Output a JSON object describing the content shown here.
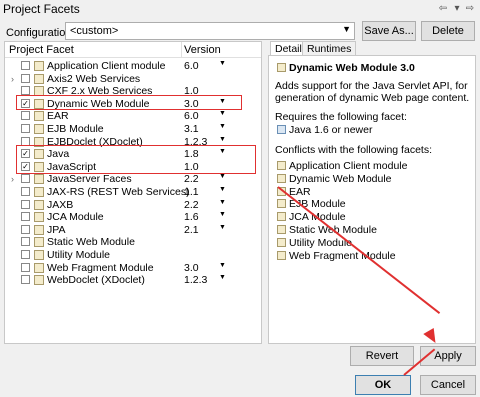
{
  "window": {
    "title": "Project Facets"
  },
  "configuration": {
    "label": "Configuration:",
    "value": "<custom>",
    "save_as": "Save As...",
    "delete": "Delete"
  },
  "facets": {
    "headers": {
      "name": "Project Facet",
      "version": "Version"
    },
    "rows": [
      {
        "name": "Application Client module",
        "version": "6.0",
        "checked": false,
        "expandable": false,
        "dropdown": true
      },
      {
        "name": "Axis2 Web Services",
        "version": "",
        "checked": false,
        "expandable": true,
        "dropdown": false
      },
      {
        "name": "CXF 2.x Web Services",
        "version": "1.0",
        "checked": false,
        "expandable": false,
        "dropdown": false
      },
      {
        "name": "Dynamic Web Module",
        "version": "3.0",
        "checked": true,
        "expandable": false,
        "dropdown": true
      },
      {
        "name": "EAR",
        "version": "6.0",
        "checked": false,
        "expandable": false,
        "dropdown": true
      },
      {
        "name": "EJB Module",
        "version": "3.1",
        "checked": false,
        "expandable": false,
        "dropdown": true
      },
      {
        "name": "EJBDoclet (XDoclet)",
        "version": "1.2.3",
        "checked": false,
        "expandable": false,
        "dropdown": true
      },
      {
        "name": "Java",
        "version": "1.8",
        "checked": true,
        "expandable": false,
        "dropdown": true
      },
      {
        "name": "JavaScript",
        "version": "1.0",
        "checked": true,
        "expandable": false,
        "dropdown": false
      },
      {
        "name": "JavaServer Faces",
        "version": "2.2",
        "checked": false,
        "expandable": true,
        "dropdown": true
      },
      {
        "name": "JAX-RS (REST Web Services)",
        "version": "1.1",
        "checked": false,
        "expandable": false,
        "dropdown": true
      },
      {
        "name": "JAXB",
        "version": "2.2",
        "checked": false,
        "expandable": false,
        "dropdown": true
      },
      {
        "name": "JCA Module",
        "version": "1.6",
        "checked": false,
        "expandable": false,
        "dropdown": true
      },
      {
        "name": "JPA",
        "version": "2.1",
        "checked": false,
        "expandable": false,
        "dropdown": true
      },
      {
        "name": "Static Web Module",
        "version": "",
        "checked": false,
        "expandable": false,
        "dropdown": false
      },
      {
        "name": "Utility Module",
        "version": "",
        "checked": false,
        "expandable": false,
        "dropdown": false
      },
      {
        "name": "Web Fragment Module",
        "version": "3.0",
        "checked": false,
        "expandable": false,
        "dropdown": true
      },
      {
        "name": "WebDoclet (XDoclet)",
        "version": "1.2.3",
        "checked": false,
        "expandable": false,
        "dropdown": true
      }
    ]
  },
  "details": {
    "tabs": [
      "Details",
      "Runtimes"
    ],
    "title": "Dynamic Web Module 3.0",
    "description": "Adds support for the Java Servlet API, for generation of dynamic Web page content.",
    "requires_label": "Requires the following facet:",
    "requires": [
      "Java 1.6 or newer"
    ],
    "conflicts_label": "Conflicts with the following facets:",
    "conflicts": [
      "Application Client module",
      "Dynamic Web Module",
      "EAR",
      "EJB Module",
      "JCA Module",
      "Static Web Module",
      "Utility Module",
      "Web Fragment Module"
    ]
  },
  "buttons": {
    "revert": "Revert",
    "apply": "Apply",
    "ok": "OK",
    "cancel": "Cancel"
  },
  "annotation_color": "#e03030"
}
